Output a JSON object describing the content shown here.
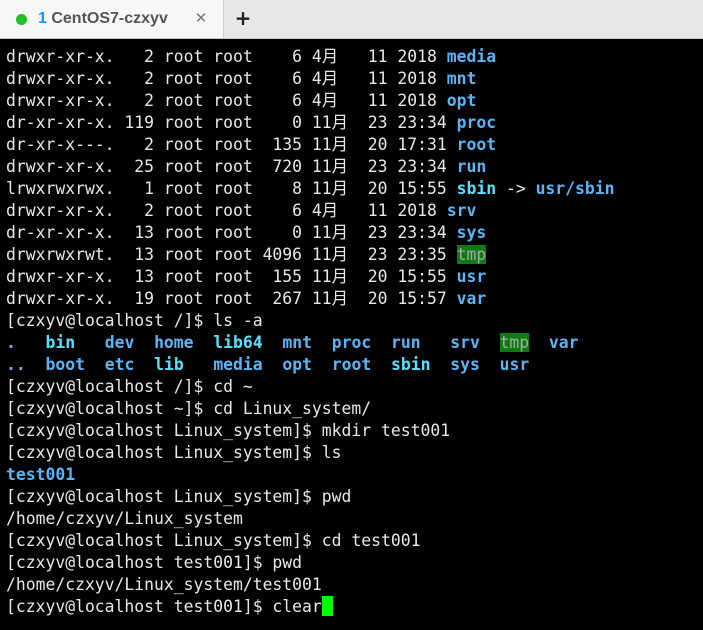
{
  "tab": {
    "number": "1",
    "title": " CentOS7-czxyv",
    "status_color": "#22c022",
    "close_glyph": "✕",
    "new_glyph": "+"
  },
  "terminal": {
    "lines": [
      [
        {
          "t": "drwxr-xr-x.   2 root root    6 4月   11 2018 "
        },
        {
          "t": "media",
          "c": "dir"
        }
      ],
      [
        {
          "t": "drwxr-xr-x.   2 root root    6 4月   11 2018 "
        },
        {
          "t": "mnt",
          "c": "dir"
        }
      ],
      [
        {
          "t": "drwxr-xr-x.   2 root root    6 4月   11 2018 "
        },
        {
          "t": "opt",
          "c": "dir"
        }
      ],
      [
        {
          "t": "dr-xr-xr-x. 119 root root    0 11月  23 23:34 "
        },
        {
          "t": "proc",
          "c": "dir"
        }
      ],
      [
        {
          "t": "dr-xr-x---.   2 root root  135 11月  20 17:31 "
        },
        {
          "t": "root",
          "c": "dir"
        }
      ],
      [
        {
          "t": "drwxr-xr-x.  25 root root  720 11月  23 23:34 "
        },
        {
          "t": "run",
          "c": "dir"
        }
      ],
      [
        {
          "t": "lrwxrwxrwx.   1 root root    8 11月  20 15:55 "
        },
        {
          "t": "sbin",
          "c": "lnk"
        },
        {
          "t": " -> "
        },
        {
          "t": "usr/sbin",
          "c": "dir"
        }
      ],
      [
        {
          "t": "drwxr-xr-x.   2 root root    6 4月   11 2018 "
        },
        {
          "t": "srv",
          "c": "dir"
        }
      ],
      [
        {
          "t": "dr-xr-xr-x.  13 root root    0 11月  23 23:34 "
        },
        {
          "t": "sys",
          "c": "dir"
        }
      ],
      [
        {
          "t": "drwxrwxrwt.  13 root root 4096 11月  23 23:35 "
        },
        {
          "t": "tmp",
          "c": "sticky"
        }
      ],
      [
        {
          "t": "drwxr-xr-x.  13 root root  155 11月  20 15:55 "
        },
        {
          "t": "usr",
          "c": "dir"
        }
      ],
      [
        {
          "t": "drwxr-xr-x.  19 root root  267 11月  20 15:57 "
        },
        {
          "t": "var",
          "c": "dir"
        }
      ],
      [
        {
          "t": "[czxyv@localhost /]$ ls -a"
        }
      ],
      [
        {
          "t": ".",
          "c": "dir"
        },
        {
          "t": "   "
        },
        {
          "t": "bin",
          "c": "lnk"
        },
        {
          "t": "   "
        },
        {
          "t": "dev",
          "c": "dir"
        },
        {
          "t": "  "
        },
        {
          "t": "home",
          "c": "dir"
        },
        {
          "t": "  "
        },
        {
          "t": "lib64",
          "c": "lnk"
        },
        {
          "t": "  "
        },
        {
          "t": "mnt",
          "c": "dir"
        },
        {
          "t": "  "
        },
        {
          "t": "proc",
          "c": "dir"
        },
        {
          "t": "  "
        },
        {
          "t": "run",
          "c": "dir"
        },
        {
          "t": "   "
        },
        {
          "t": "srv",
          "c": "dir"
        },
        {
          "t": "  "
        },
        {
          "t": "tmp",
          "c": "sticky"
        },
        {
          "t": "  "
        },
        {
          "t": "var",
          "c": "dir"
        }
      ],
      [
        {
          "t": "..",
          "c": "dir"
        },
        {
          "t": "  "
        },
        {
          "t": "boot",
          "c": "dir"
        },
        {
          "t": "  "
        },
        {
          "t": "etc",
          "c": "dir"
        },
        {
          "t": "  "
        },
        {
          "t": "lib",
          "c": "lnk"
        },
        {
          "t": "   "
        },
        {
          "t": "media",
          "c": "dir"
        },
        {
          "t": "  "
        },
        {
          "t": "opt",
          "c": "dir"
        },
        {
          "t": "  "
        },
        {
          "t": "root",
          "c": "dir"
        },
        {
          "t": "  "
        },
        {
          "t": "sbin",
          "c": "lnk"
        },
        {
          "t": "  "
        },
        {
          "t": "sys",
          "c": "dir"
        },
        {
          "t": "  "
        },
        {
          "t": "usr",
          "c": "dir"
        }
      ],
      [
        {
          "t": "[czxyv@localhost /]$ cd ~"
        }
      ],
      [
        {
          "t": "[czxyv@localhost ~]$ cd Linux_system/"
        }
      ],
      [
        {
          "t": "[czxyv@localhost Linux_system]$ mkdir test001"
        }
      ],
      [
        {
          "t": "[czxyv@localhost Linux_system]$ ls"
        }
      ],
      [
        {
          "t": "test001",
          "c": "dir"
        }
      ],
      [
        {
          "t": "[czxyv@localhost Linux_system]$ pwd"
        }
      ],
      [
        {
          "t": "/home/czxyv/Linux_system"
        }
      ],
      [
        {
          "t": "[czxyv@localhost Linux_system]$ cd test001"
        }
      ],
      [
        {
          "t": "[czxyv@localhost test001]$ pwd"
        }
      ],
      [
        {
          "t": "/home/czxyv/Linux_system/test001"
        }
      ],
      [
        {
          "t": "[czxyv@localhost test001]$ clear"
        },
        {
          "cursor": true
        }
      ]
    ]
  }
}
